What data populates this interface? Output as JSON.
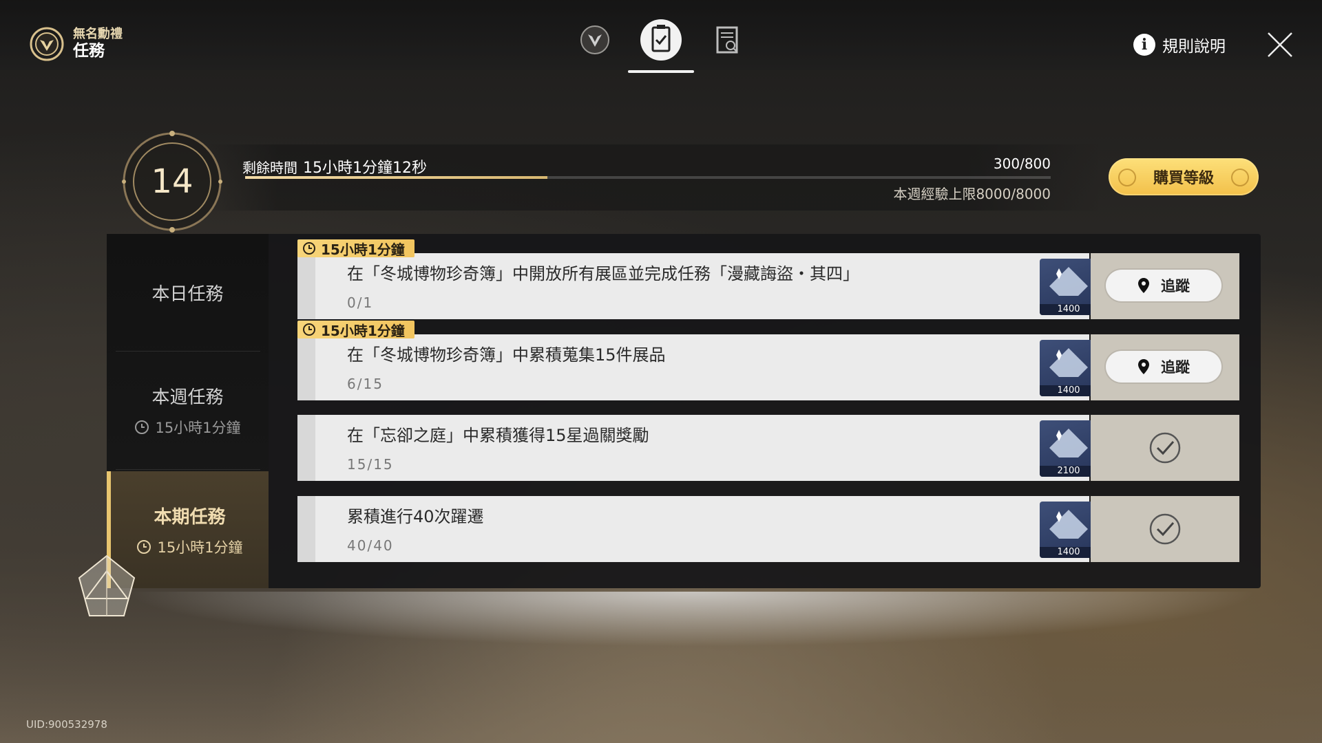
{
  "header": {
    "brand_sub": "無名勳禮",
    "brand_title": "任務",
    "rules_label": "規則說明",
    "nav_tabs": [
      {
        "icon": "emblem-icon",
        "active": false
      },
      {
        "icon": "clipboard-check-icon",
        "active": true
      },
      {
        "icon": "document-search-icon",
        "active": false
      }
    ]
  },
  "level": {
    "number": "14",
    "remaining_label": "剩餘時間",
    "remaining_value": "15小時1分鐘12秒",
    "exp_value": "300/800",
    "exp_progress": 0.375,
    "weekly_cap": "本週經驗上限8000/8000",
    "buy_label": "購買等級"
  },
  "sidebar": {
    "items": [
      {
        "label": "本日任務",
        "timer": ""
      },
      {
        "label": "本週任務",
        "timer": "15小時1分鐘"
      },
      {
        "label": "本期任務",
        "timer": "15小時1分鐘"
      }
    ],
    "active_index": 2
  },
  "tasks": [
    {
      "tag": "15小時1分鐘",
      "text": "在「冬城博物珍奇簿」中開放所有展區並完成任務「漫藏誨盜・其四」",
      "progress": "0/1",
      "reward": "1400",
      "action": "track",
      "action_label": "追蹤"
    },
    {
      "tag": "15小時1分鐘",
      "text": "在「冬城博物珍奇簿」中累積蒐集15件展品",
      "progress": "6/15",
      "reward": "1400",
      "action": "track",
      "action_label": "追蹤"
    },
    {
      "tag": "",
      "text": "在「忘卻之庭」中累積獲得15星過關獎勵",
      "progress": "15/15",
      "reward": "2100",
      "action": "done",
      "action_label": ""
    },
    {
      "tag": "",
      "text": "累積進行40次躍遷",
      "progress": "40/40",
      "reward": "1400",
      "action": "done",
      "action_label": ""
    }
  ],
  "uid": "UID:900532978",
  "colors": {
    "accent_gold": "#f2c04a",
    "panel": "#161618"
  }
}
